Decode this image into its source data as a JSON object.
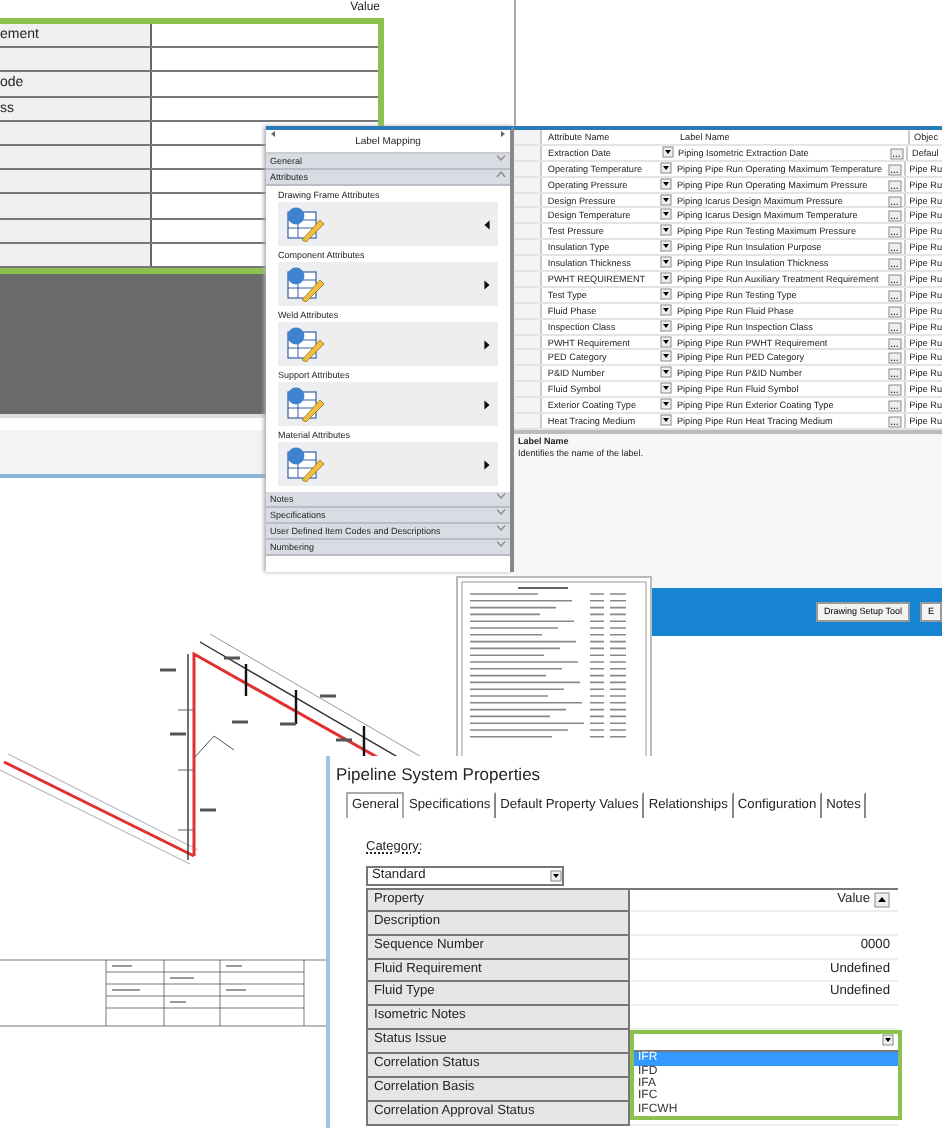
{
  "property_grid": {
    "header": "Value",
    "rows": [
      {
        "label": "ement"
      },
      {},
      {
        "label": "ode"
      },
      {
        "label": "ss"
      },
      {},
      {},
      {},
      {},
      {},
      {}
    ]
  },
  "label_mapping": {
    "title": "Label Mapping",
    "sections": [
      {
        "label": "General",
        "expanded": false
      },
      {
        "label": "Attributes",
        "expanded": true,
        "items": [
          {
            "label": "Drawing Frame Attributes",
            "selected": true
          },
          {
            "label": "Component Attributes",
            "selected": false
          },
          {
            "label": "Weld Attributes",
            "selected": false
          },
          {
            "label": "Support Attributes",
            "selected": false
          },
          {
            "label": "Material Attributes",
            "selected": false
          }
        ]
      },
      {
        "label": "Notes",
        "expanded": false
      },
      {
        "label": "Specifications",
        "expanded": false
      },
      {
        "label": "User Defined Item Codes and Descriptions",
        "expanded": false
      },
      {
        "label": "Numbering",
        "expanded": false
      }
    ]
  },
  "attribute_table": {
    "columns": [
      "Attribute Name",
      "Label Name",
      "Objec"
    ],
    "rows": [
      [
        "Extraction Date",
        "Piping Isometric Extraction Date",
        "Defaul"
      ],
      [
        "Operating Temperature",
        "Piping Pipe Run Operating Maximum Temperature",
        "Pipe Ru"
      ],
      [
        "Operating Pressure",
        "Piping Pipe Run Operating Maximum Pressure",
        "Pipe Ru"
      ],
      [
        "Design Pressure",
        "Piping Icarus Design Maximum Pressure",
        "Pipe Ru"
      ],
      [
        "Design Temperature",
        "Piping Icarus Design Maximum Temperature",
        "Pipe Ru"
      ],
      [
        "Test Pressure",
        "Piping Pipe Run Testing Maximum Pressure",
        "Pipe Ru"
      ],
      [
        "Insulation Type",
        "Piping Pipe Run Insulation Purpose",
        "Pipe Ru"
      ],
      [
        "Insulation Thickness",
        "Piping Pipe Run Insulation Thickness",
        "Pipe Ru"
      ],
      [
        "PWHT REQUIREMENT",
        "Piping Pipe Run Auxiliary Treatment Requirement",
        "Pipe Ru"
      ],
      [
        "Test Type",
        "Piping Pipe Run Testing Type",
        "Pipe Ru"
      ],
      [
        "Fluid Phase",
        "Piping Pipe Run Fluid Phase",
        "Pipe Ru"
      ],
      [
        "Inspection Class",
        "Piping Pipe Run Inspection Class",
        "Pipe Ru"
      ],
      [
        "PWHT Requirement",
        "Piping Pipe Run PWHT Requirement",
        "Pipe Ru"
      ],
      [
        "PED Category",
        "Piping Pipe Run PED Category",
        "Pipe Ru"
      ],
      [
        "P&ID Number",
        "Piping Pipe Run P&ID Number",
        "Pipe Ru"
      ],
      [
        "Fluid Symbol",
        "Piping Pipe Run Fluid Symbol",
        "Pipe Ru"
      ],
      [
        "Exterior Coating Type",
        "Piping Pipe Run Exterior Coating Type",
        "Pipe Ru"
      ],
      [
        "Heat Tracing Medium",
        "Piping Pipe Run Heat Tracing Medium",
        "Pipe Ru"
      ]
    ],
    "description": {
      "title": "Label Name",
      "text": "Identifies the name of the label."
    }
  },
  "toolbar": {
    "buttons": [
      "Drawing Setup Tool",
      "E"
    ]
  },
  "pipeline_dialog": {
    "title": "Pipeline System Properties",
    "tabs": [
      {
        "label": "General",
        "selected": true
      },
      {
        "label": "Specifications",
        "selected": false
      },
      {
        "label": "Default Property Values",
        "selected": false
      },
      {
        "label": "Relationships",
        "selected": false
      },
      {
        "label": "Configuration",
        "selected": false
      },
      {
        "label": "Notes",
        "selected": false
      }
    ],
    "category": {
      "label": "Category:",
      "value": "Standard"
    },
    "columns": [
      "Property",
      "Value"
    ],
    "rows": [
      {
        "kind": "text",
        "property": "Description"
      },
      {
        "kind": "text",
        "property": "Sequence Number",
        "value": "0000"
      },
      {
        "kind": "text",
        "property": "Fluid Requirement",
        "value": "Undefined"
      },
      {
        "kind": "text",
        "property": "Fluid Type",
        "value": "Undefined"
      },
      {
        "kind": "text",
        "property": "Isometric Notes"
      },
      {
        "kind": "dropdown",
        "property": "Status Issue",
        "options": [
          {
            "label": "IFR",
            "selected": true
          },
          {
            "label": "IFD",
            "selected": false
          },
          {
            "label": "IFA",
            "selected": false
          },
          {
            "label": "IFC",
            "selected": false
          },
          {
            "label": "IFCWH",
            "selected": false
          }
        ]
      },
      {
        "kind": "text",
        "property": "Correlation Status"
      },
      {
        "kind": "text",
        "property": "Correlation Basis"
      },
      {
        "kind": "text",
        "property": "Correlation Approval Status"
      }
    ]
  }
}
